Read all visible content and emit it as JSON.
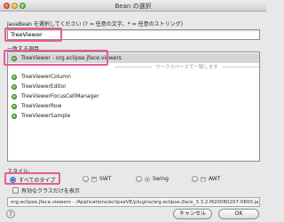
{
  "window": {
    "title": "Bean の選択"
  },
  "prompt": "JavaBean を選択してください (? = 任意の文字、* = 任意のストリング)",
  "filter": {
    "value": "TreeViewer"
  },
  "matches_label": "一致する項目:",
  "list": {
    "selected": "TreeViewer - org.eclipse.jface.viewers",
    "separator": "ワークスペースで一致します",
    "items": [
      "TreeViewerColumn",
      "TreeViewerEditor",
      "TreeViewerFocusCellManager",
      "TreeViewerRow",
      "TreeViewerSample"
    ]
  },
  "style": {
    "label": "スタイル:",
    "options": [
      "すべてのタイプ",
      "SWT",
      "Swing",
      "AWT"
    ],
    "selected_index": 0,
    "checkbox_label": "有効なクラスだけを表示"
  },
  "path": "org.eclipse.jface.viewers - /Applications/eclipseVE/plugins/org.eclipse.jface_3.3.2.M20080207-0800.jar",
  "buttons": {
    "help": "?",
    "cancel": "キャンセル",
    "ok": "OK"
  },
  "colors": {
    "highlight": "#ea5a9c",
    "selected_row": "#d6d6d6"
  }
}
